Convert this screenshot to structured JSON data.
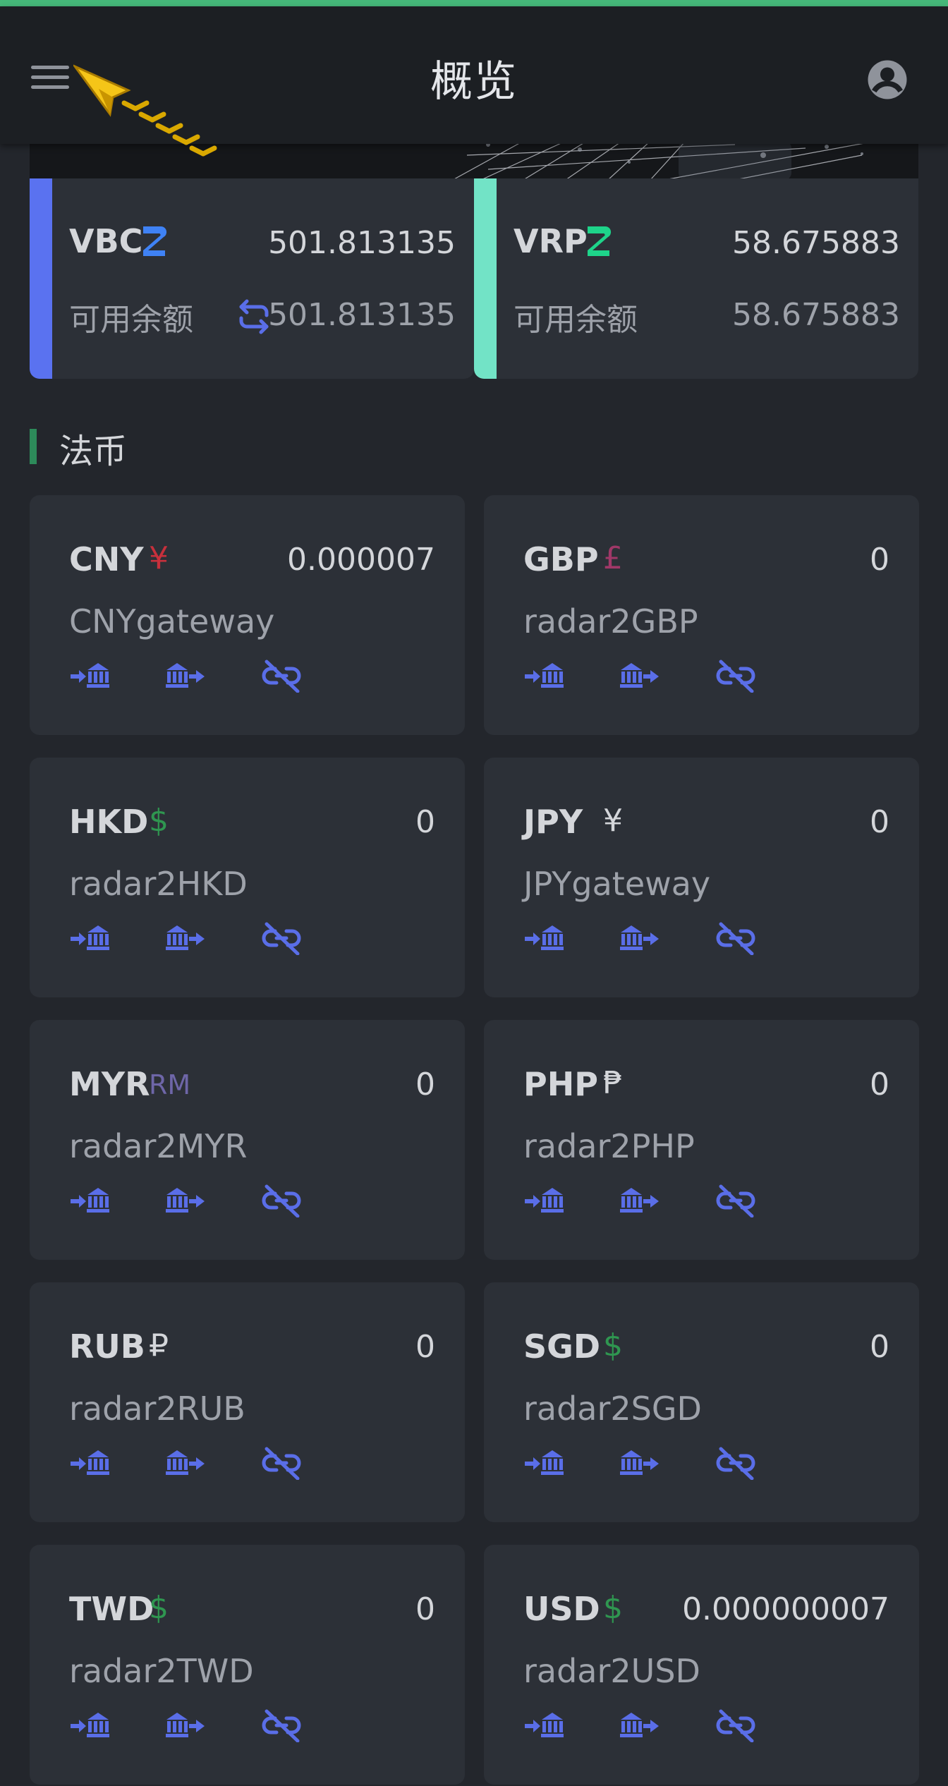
{
  "header": {
    "title": "概览",
    "menu_icon": "menu-icon",
    "account_icon": "account-circle-icon"
  },
  "tokens": [
    {
      "code": "VBC",
      "amount": "501.813135",
      "available_label": "可用余额",
      "available": "501.813135",
      "stripe_color": "#5a72f0",
      "logo_color": "#3f82f5",
      "has_swap": true
    },
    {
      "code": "VRP",
      "amount": "58.675883",
      "available_label": "可用余额",
      "available": "58.675883",
      "stripe_color": "#72e3c6",
      "logo_color": "#1ed48a",
      "has_swap": false
    }
  ],
  "section": {
    "title": "法币"
  },
  "fiat": [
    {
      "code": "CNY",
      "symbol": "¥",
      "symbol_color": "#c8303c",
      "amount": "0.000007",
      "gateway": "CNYgateway"
    },
    {
      "code": "GBP",
      "symbol": "£",
      "symbol_color": "#a03868",
      "amount": "0",
      "gateway": "radar2GBP"
    },
    {
      "code": "HKD",
      "symbol": "$",
      "symbol_color": "#2f9650",
      "amount": "0",
      "gateway": "radar2HKD"
    },
    {
      "code": "JPY",
      "symbol": "¥",
      "symbol_color": "#d4d6da",
      "amount": "0",
      "gateway": "JPYgateway"
    },
    {
      "code": "MYR",
      "symbol": "RM",
      "symbol_color": "#6e66a8",
      "amount": "0",
      "gateway": "radar2MYR"
    },
    {
      "code": "PHP",
      "symbol": "₱",
      "symbol_color": "#d4d6da",
      "amount": "0",
      "gateway": "radar2PHP"
    },
    {
      "code": "RUB",
      "symbol": "₽",
      "symbol_color": "#d4d6da",
      "amount": "0",
      "gateway": "radar2RUB"
    },
    {
      "code": "SGD",
      "symbol": "$",
      "symbol_color": "#2f9650",
      "amount": "0",
      "gateway": "radar2SGD"
    },
    {
      "code": "TWD",
      "symbol": "$",
      "symbol_color": "#2f9650",
      "amount": "0",
      "gateway": "radar2TWD"
    },
    {
      "code": "USD",
      "symbol": "$",
      "symbol_color": "#2f9650",
      "amount": "0.000000007",
      "gateway": "radar2USD"
    }
  ],
  "actions": [
    {
      "name": "deposit-bank-icon"
    },
    {
      "name": "withdraw-bank-icon"
    },
    {
      "name": "unlink-icon"
    }
  ],
  "colors": {
    "accent": "#5a6ee8",
    "header_bg": "#1c1f23",
    "page_bg": "#23262c",
    "card_bg": "#2c3037",
    "top_line": "#45b779"
  }
}
